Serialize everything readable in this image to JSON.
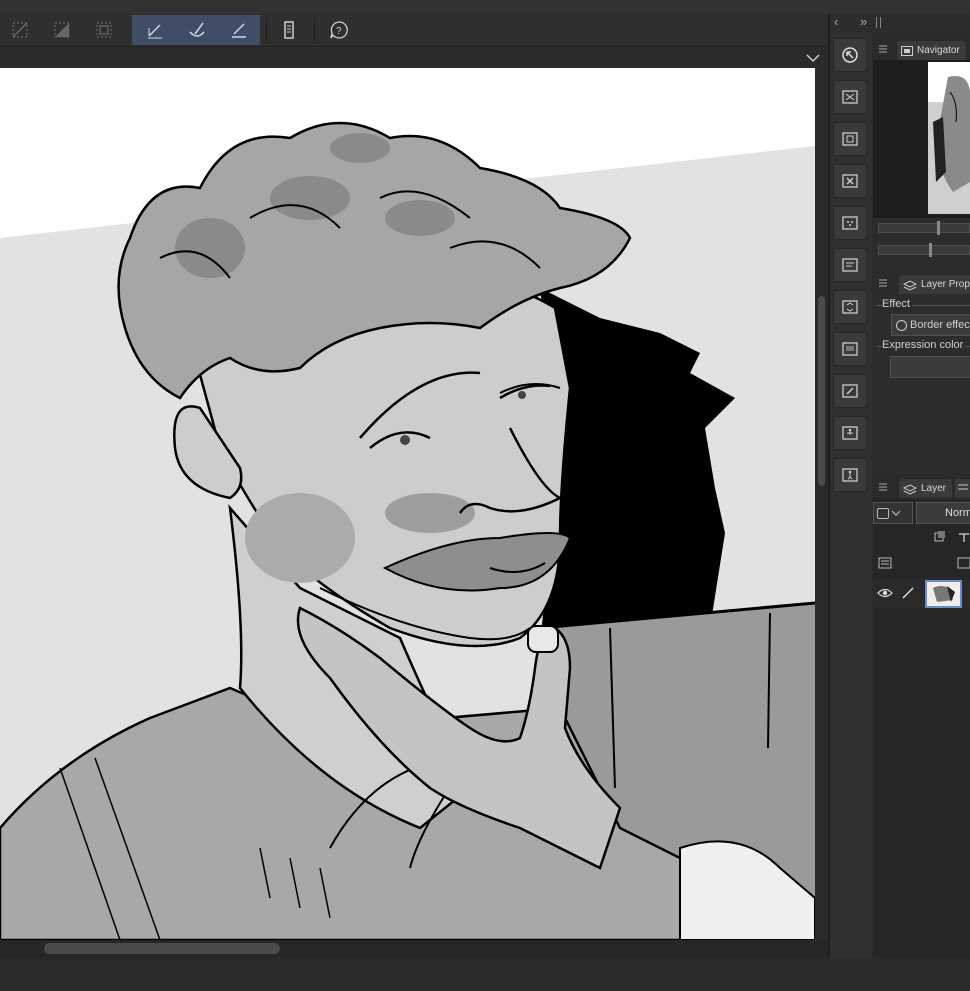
{
  "toolbar": {
    "icons": [
      "selection-clear-icon",
      "invert-selection-icon",
      "selection-border-icon",
      "pen-stroke-icon",
      "brush-stroke-icon",
      "pencil-stroke-icon",
      "ruler-settings-icon",
      "help-icon"
    ],
    "active_group_color": "#3f4d66"
  },
  "canvas": {
    "artwork": "grayscale sketch"
  },
  "side_column": {
    "collapse_glyph": "‹",
    "expand_glyph": "»"
  },
  "navigator": {
    "title": "Navigator"
  },
  "layer_property": {
    "title": "Layer Prope",
    "effect_label": "Effect",
    "border_effect_label": "Border effect",
    "expression_color_label": "Expression color"
  },
  "layer_panel": {
    "title": "Layer",
    "blend_mode": "Norm",
    "accent_color": "#6d8bc8"
  }
}
